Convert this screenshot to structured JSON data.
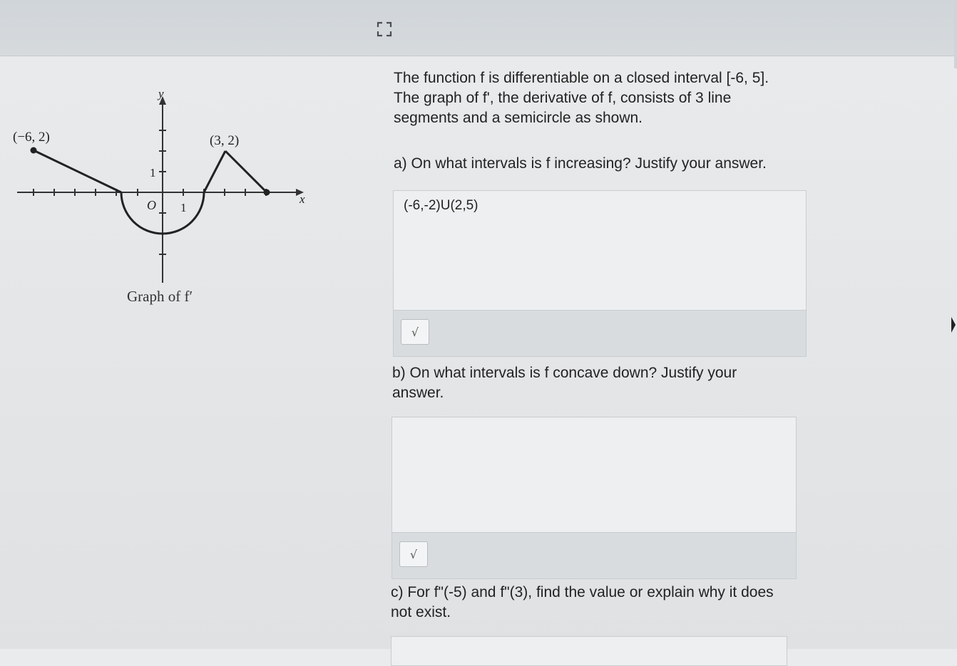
{
  "graph": {
    "point_left": "(−6, 2)",
    "point_right": "(3, 2)",
    "y_label": "y",
    "x_label": "x",
    "origin_label": "O",
    "tick_one_x": "1",
    "tick_one_y": "1",
    "caption": "Graph of f′"
  },
  "intro": "The function f is differentiable on a closed interval [-6, 5]. The graph of f', the derivative of f, consists of 3 line segments and a semicircle as shown.",
  "question_a": {
    "prompt": "a) On what intervals is f increasing? Justify your answer.",
    "answer": "(-6,-2)U(2,5)",
    "math_button": "√"
  },
  "question_b": {
    "prompt": "b)  On what intervals is f concave down?  Justify your answer.",
    "answer": "",
    "math_button": "√"
  },
  "question_c": {
    "prompt": "c) For f\"(-5) and f\"(3), find the value or explain why it does not exist."
  }
}
